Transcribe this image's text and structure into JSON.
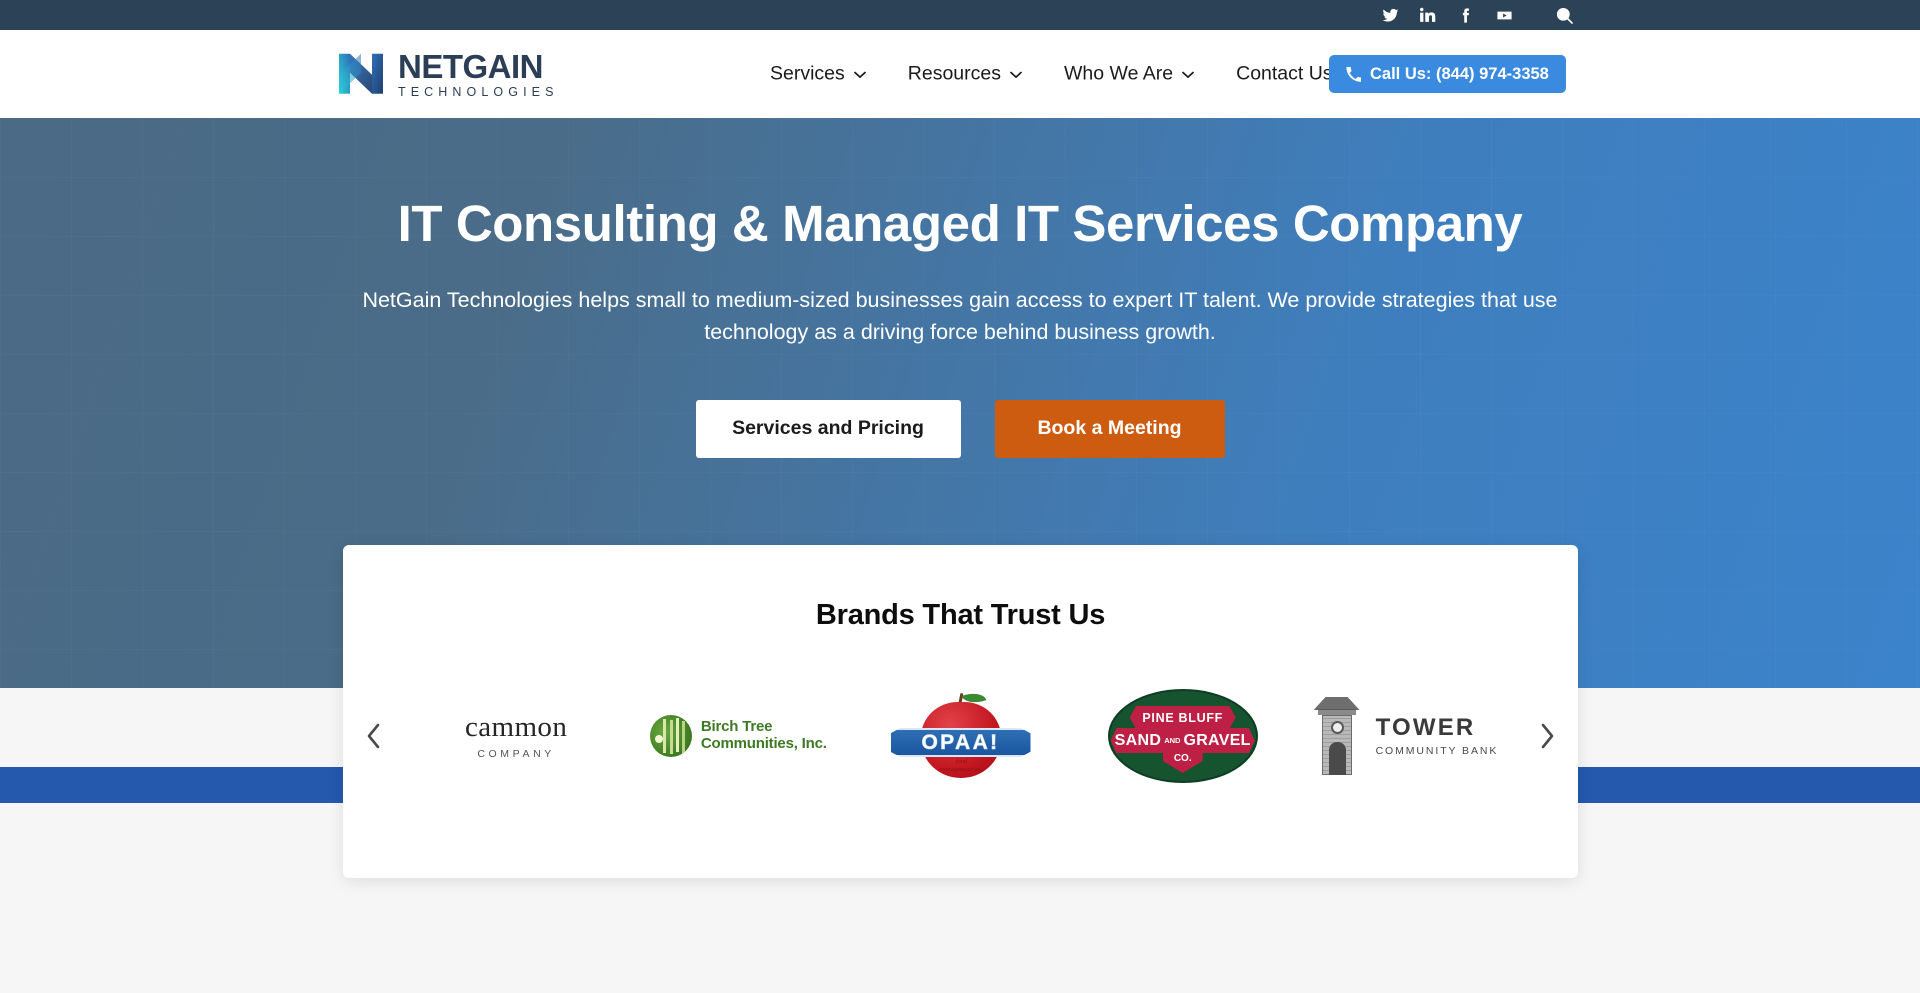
{
  "topbar": {
    "social": [
      {
        "name": "twitter-icon",
        "label": "Twitter"
      },
      {
        "name": "linkedin-icon",
        "label": "LinkedIn"
      },
      {
        "name": "facebook-icon",
        "label": "Facebook"
      },
      {
        "name": "youtube-icon",
        "label": "YouTube"
      }
    ],
    "search_label": "Search"
  },
  "header": {
    "logo_name": "NETGAIN",
    "logo_sub": "TECHNOLOGIES",
    "nav": [
      {
        "label": "Services",
        "has_dropdown": true
      },
      {
        "label": "Resources",
        "has_dropdown": true
      },
      {
        "label": "Who We Are",
        "has_dropdown": true
      },
      {
        "label": "Contact Us",
        "has_dropdown": true
      }
    ],
    "call_label": "Call Us: (844) 974-3358",
    "call_bg": "#3a8ae0"
  },
  "hero": {
    "title": "IT Consulting & Managed IT Services Company",
    "subtitle": "NetGain Technologies helps small to medium-sized businesses gain access to expert IT talent. We provide strategies that use technology as a driving force behind business growth.",
    "primary_btn": "Services and Pricing",
    "secondary_btn": "Book a Meeting",
    "secondary_bg": "#ce5c10",
    "gradient_from": "#4b6a85",
    "gradient_to": "#3b83cb"
  },
  "brands": {
    "title": "Brands That Trust Us",
    "prev_label": "Previous",
    "next_label": "Next",
    "logos": [
      {
        "id": "cammon",
        "name": "cammon",
        "sub": "COMPANY"
      },
      {
        "id": "birch-tree",
        "line1": "Birch Tree",
        "line2": "Communities, Inc."
      },
      {
        "id": "opaa",
        "name": "OPAA!",
        "tagline": "food management inc."
      },
      {
        "id": "pine-bluff",
        "top": "PINE BLUFF",
        "mid1": "SAND",
        "mid2": "AND",
        "mid3": "GRAVEL",
        "bottom": "CO."
      },
      {
        "id": "tower",
        "name": "TOWER",
        "sub": "COMMUNITY BANK"
      }
    ]
  },
  "footer_band": {
    "color": "#2459ae"
  }
}
